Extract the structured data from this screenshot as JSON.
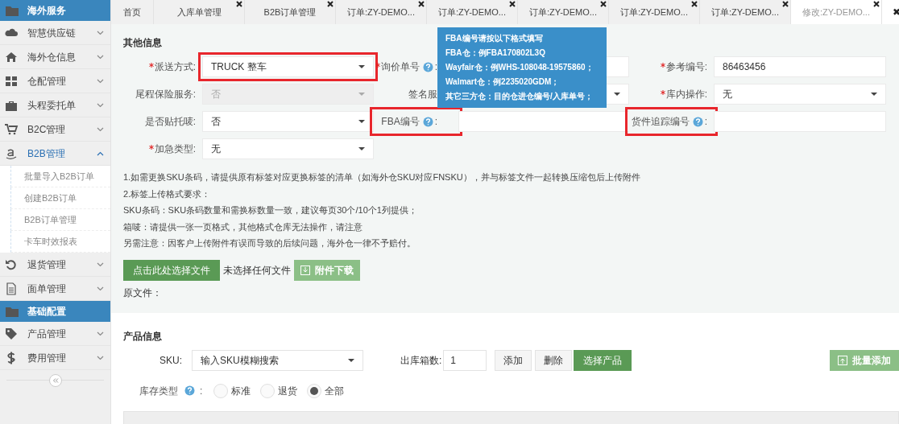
{
  "sidebar": {
    "sections": [
      {
        "title": "海外服务",
        "items": [
          {
            "label": "智慧供应链",
            "expanded": false
          },
          {
            "label": "海外仓信息",
            "expanded": false
          },
          {
            "label": "仓配管理",
            "expanded": false
          },
          {
            "label": "头程委托单",
            "expanded": false
          },
          {
            "label": "B2C管理",
            "expanded": false
          },
          {
            "label": "B2B管理",
            "expanded": true,
            "children": [
              {
                "label": "批量导入B2B订单"
              },
              {
                "label": "创建B2B订单"
              },
              {
                "label": "B2B订单管理"
              },
              {
                "label": "卡车时效报表"
              }
            ]
          },
          {
            "label": "退货管理",
            "expanded": false
          },
          {
            "label": "面单管理",
            "expanded": false
          }
        ]
      },
      {
        "title": "基础配置",
        "items": [
          {
            "label": "产品管理",
            "expanded": false
          },
          {
            "label": "费用管理",
            "expanded": false
          }
        ]
      }
    ]
  },
  "tabs": [
    {
      "label": "首页",
      "selected": false,
      "closable": false
    },
    {
      "label": "入库单管理",
      "selected": false,
      "closable": true
    },
    {
      "label": "B2B订单管理",
      "selected": false,
      "closable": true
    },
    {
      "label": "订单:ZY-DEMO...",
      "selected": false,
      "closable": true
    },
    {
      "label": "订单:ZY-DEMO...",
      "selected": false,
      "closable": true
    },
    {
      "label": "订单:ZY-DEMO...",
      "selected": false,
      "closable": true
    },
    {
      "label": "订单:ZY-DEMO...",
      "selected": false,
      "closable": true
    },
    {
      "label": "订单:ZY-DEMO...",
      "selected": false,
      "closable": true
    },
    {
      "label": "修改:ZY-DEMO...",
      "selected": true,
      "closable": true
    }
  ],
  "close_all": "✖",
  "other_info": {
    "title": "其他信息",
    "rows": [
      {
        "fields": [
          {
            "label": "派送方式:",
            "required": true,
            "help": false,
            "kind": "select",
            "value": "TRUCK 整车",
            "disabled": false,
            "highlighted": true
          },
          {
            "label": "询价单号",
            "required": true,
            "help": true,
            "label_suffix": ":",
            "kind": "input",
            "highlighted": false
          },
          {
            "label": "参考编号:",
            "required": true,
            "help": false,
            "kind": "input",
            "value": "86463456",
            "highlighted": false
          }
        ]
      },
      {
        "fields": [
          {
            "label": "尾程保险服务:",
            "required": false,
            "help": false,
            "kind": "select",
            "value": "否",
            "disabled": true,
            "highlighted": false
          },
          {
            "label": "签名服",
            "required": false,
            "help": false,
            "kind": "select",
            "disabled": false,
            "highlighted": false
          },
          {
            "label": "库内操作:",
            "required": true,
            "help": false,
            "kind": "select",
            "value": "无",
            "disabled": false,
            "highlighted": false
          }
        ]
      },
      {
        "fields": [
          {
            "label": "是否贴托唛:",
            "required": false,
            "help": false,
            "kind": "select",
            "value": "否",
            "disabled": false,
            "highlighted": false
          },
          {
            "label": "FBA编号",
            "required": false,
            "help": true,
            "label_suffix": ":",
            "kind": "input",
            "highlighted": true
          },
          {
            "label": "货件追踪编号",
            "required": false,
            "help": true,
            "label_suffix": ":",
            "kind": "input",
            "highlighted": true
          }
        ]
      },
      {
        "fields": [
          {
            "label": "加急类型:",
            "required": true,
            "help": false,
            "kind": "select",
            "value": "无",
            "disabled": false,
            "highlighted": false
          }
        ]
      }
    ],
    "tooltip": [
      "FBA编号请按以下格式填写",
      "FBA仓：例FBA170802L3Q",
      "Wayfair仓：例WHS-108048-19575860；",
      "Walmart仓：例2235020GDM；",
      "其它三方仓：目的仓进仓编号/入库单号；"
    ],
    "notes": [
      "1.如需更换SKU条码，请提供原有标签对应更换标签的清单（如海外仓SKU对应FNSKU），并与标签文件一起转换压缩包后上传附件",
      "2.标签上传格式要求：",
      "SKU条码：SKU条码数量和需换标数量一致，建议每页30个/10个1列提供；",
      "箱唛：请提供一张一页格式，其他格式仓库无法操作，请注意",
      "另需注意：因客户上传附件有误而导致的后续问题，海外仓一律不予赔付。"
    ],
    "choose_file_button": "点击此处选择文件",
    "file_status": "未选择任何文件",
    "download_button": "附件下载",
    "original_file": "原文件："
  },
  "product_info": {
    "title": "产品信息",
    "sku_label": "SKU:",
    "sku_placeholder": "输入SKU模糊搜索",
    "boxes_label": "出库箱数:",
    "boxes_value": "1",
    "add_button": "添加",
    "delete_button": "删除",
    "select_button": "选择产品",
    "batch_add_button": "批量添加",
    "stock_type_label": "库存类型",
    "stock_type_suffix": ":",
    "stock_types": [
      {
        "label": "标准",
        "selected": false
      },
      {
        "label": "退货",
        "selected": false
      },
      {
        "label": "全部",
        "selected": true
      }
    ]
  }
}
